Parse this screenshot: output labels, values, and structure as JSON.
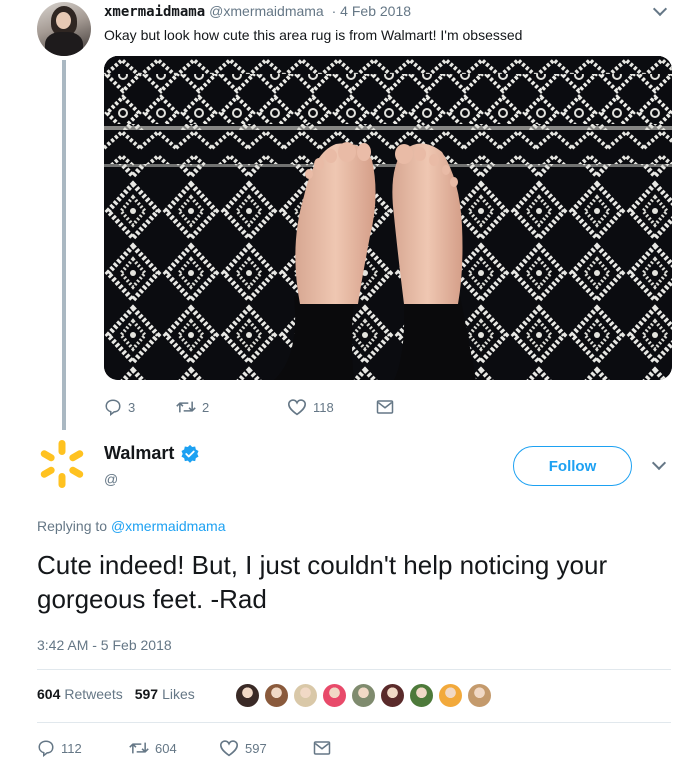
{
  "original_tweet": {
    "display_name": "xmermaidmama",
    "handle": "@xmermaidmama",
    "date": "· 4 Feb 2018",
    "text": "Okay but look how cute this area rug is from Walmart! I'm obsessed",
    "image_alt": "feet on black and white diamond pattern area rug",
    "actions": {
      "reply_count": "3",
      "retweet_count": "2",
      "like_count": "118"
    }
  },
  "reply_tweet": {
    "display_name": "Walmart",
    "handle": "@",
    "verified": true,
    "follow_label": "Follow",
    "replying_prefix": "Replying to",
    "replying_mention": "@xmermaidmama",
    "text": "Cute indeed! But, I just couldn't help noticing your gorgeous feet. -Rad",
    "timestamp": "3:42 AM - 5 Feb 2018",
    "stats": {
      "retweets_count": "604",
      "retweets_label": "Retweets",
      "likes_count": "597",
      "likes_label": "Likes"
    },
    "liker_avatar_colors": [
      "#3a2a26",
      "#8a5a3c",
      "#d9c8a8",
      "#e84a6a",
      "#7f8b6e",
      "#5a2a2a",
      "#4d7a3a",
      "#f2a93b",
      "#c49a6c"
    ],
    "actions": {
      "reply_count": "112",
      "retweet_count": "604",
      "like_count": "597"
    }
  },
  "colors": {
    "link_blue": "#1da1f2",
    "muted_gray": "#657786",
    "walmart_yellow": "#ffc220",
    "verified_blue": "#1da1f2"
  },
  "icons": [
    "reply-icon",
    "retweet-icon",
    "like-icon",
    "message-icon",
    "chevron-down-icon",
    "verified-icon",
    "walmart-spark-icon"
  ]
}
